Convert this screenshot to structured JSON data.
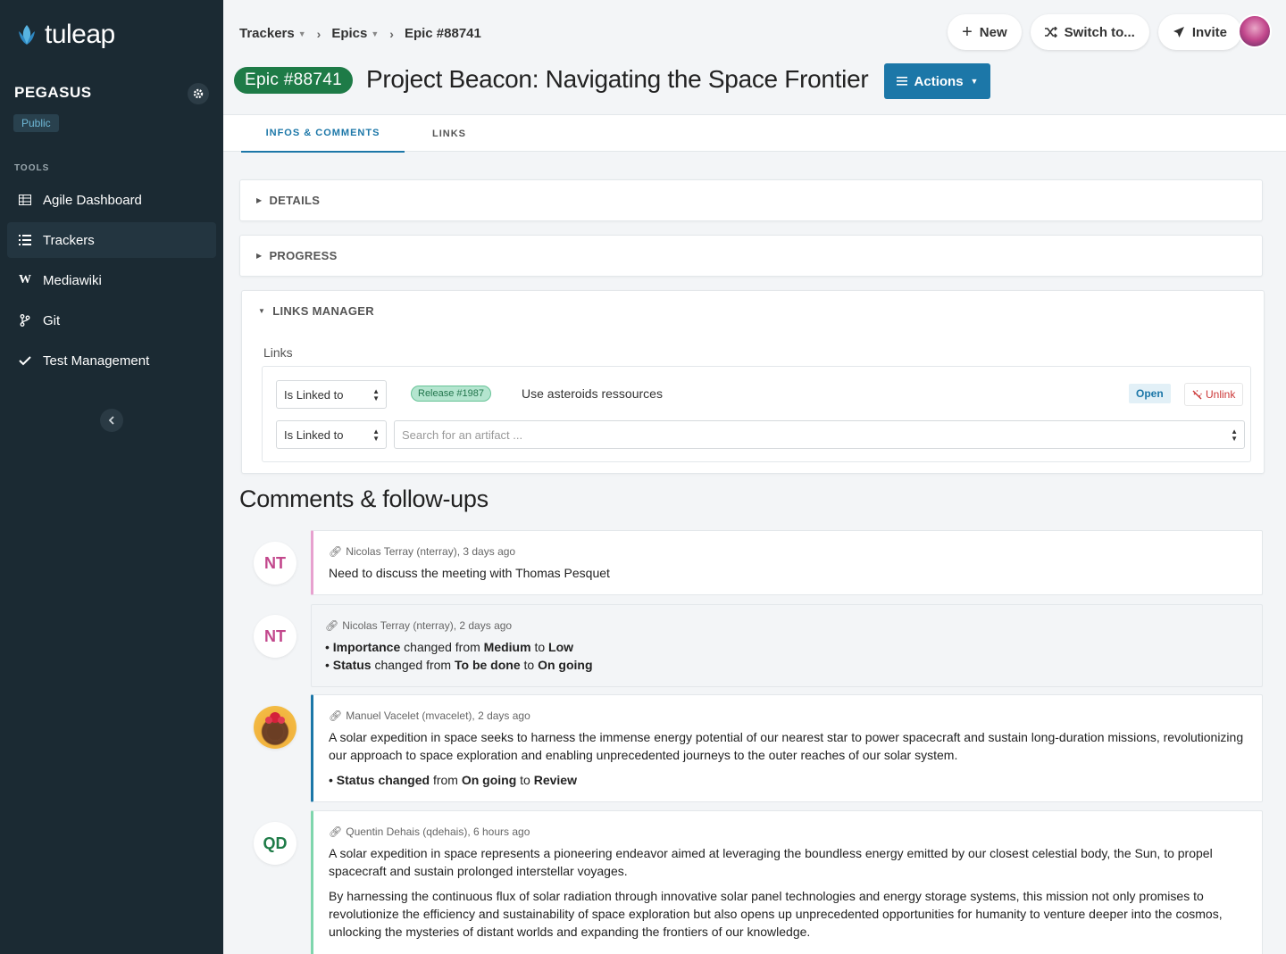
{
  "app": {
    "logo_text": "tuleap"
  },
  "sidebar": {
    "project_name": "PEGASUS",
    "visibility": "Public",
    "tools_label": "TOOLS",
    "items": [
      {
        "label": "Agile Dashboard",
        "icon": "table-icon"
      },
      {
        "label": "Trackers",
        "icon": "list-icon",
        "active": true
      },
      {
        "label": "Mediawiki",
        "icon": "wiki-icon"
      },
      {
        "label": "Git",
        "icon": "branch-icon"
      },
      {
        "label": "Test Management",
        "icon": "check-icon"
      }
    ]
  },
  "breadcrumb": {
    "items": [
      "Trackers",
      "Epics",
      "Epic #88741"
    ]
  },
  "header": {
    "new_label": "New",
    "switch_label": "Switch to...",
    "invite_label": "Invite",
    "epic_badge": "Epic #88741",
    "title": "Project Beacon: Navigating the Space Frontier",
    "actions_label": "Actions"
  },
  "tabs": [
    {
      "label": "INFOS & COMMENTS",
      "active": true
    },
    {
      "label": "LINKS",
      "active": false
    }
  ],
  "sections": {
    "details": "DETAILS",
    "progress": "PROGRESS",
    "links_manager": "LINKS MANAGER",
    "links_label": "Links"
  },
  "links": {
    "row": {
      "type": "Is Linked to",
      "badge": "Release #1987",
      "title": "Use asteroids ressources",
      "status": "Open",
      "unlink": "Unlink"
    },
    "new_row": {
      "type": "Is Linked to",
      "placeholder": "Search for an artifact ..."
    }
  },
  "comments_title": "Comments & follow-ups",
  "comments": [
    {
      "initials": "NT",
      "meta": "Nicolas Terray (nterray), 3 days ago",
      "text": "Need to discuss the meeting with Thomas Pesquet"
    },
    {
      "initials": "NT",
      "meta": "Nicolas Terray (nterray), 2 days ago",
      "changes": [
        {
          "field": "Importance",
          "mid": "changed from",
          "from": "Medium",
          "to": "Low"
        },
        {
          "field": "Status",
          "mid": "changed from",
          "from": "To be done",
          "to": "On going"
        }
      ]
    },
    {
      "meta": "Manuel Vacelet (mvacelet), 2 days ago",
      "text": "A solar expedition in space seeks to harness the immense energy potential of our nearest star to power spacecraft and sustain long-duration missions, revolutionizing our approach to space exploration and enabling unprecedented journeys to the outer reaches of our solar system.",
      "change": {
        "field": "Status changed",
        "mid": "from",
        "from": "On going",
        "to": "Review"
      }
    },
    {
      "initials": "QD",
      "meta": "Quentin Dehais (qdehais), 6 hours ago",
      "text1": "A solar expedition in space represents a pioneering endeavor aimed at leveraging the boundless energy emitted by our closest celestial body, the Sun, to propel spacecraft and sustain prolonged interstellar voyages.",
      "text2": "By harnessing the continuous flux of solar radiation through innovative solar panel technologies and energy storage systems, this mission not only promises to revolutionize the efficiency and sustainability of space exploration but also opens up unprecedented opportunities for humanity to venture deeper into the cosmos, unlocking the mysteries of distant worlds and expanding the frontiers of our knowledge."
    }
  ],
  "connector_words": {
    "to": "to"
  },
  "colors": {
    "sidebar_bg": "#1b2a33",
    "primary": "#1c77a8",
    "epic_badge": "#1e7b47",
    "comment_pink": "#e7a1cf",
    "comment_blue": "#1c77a8",
    "comment_green": "#7fd6ad"
  }
}
